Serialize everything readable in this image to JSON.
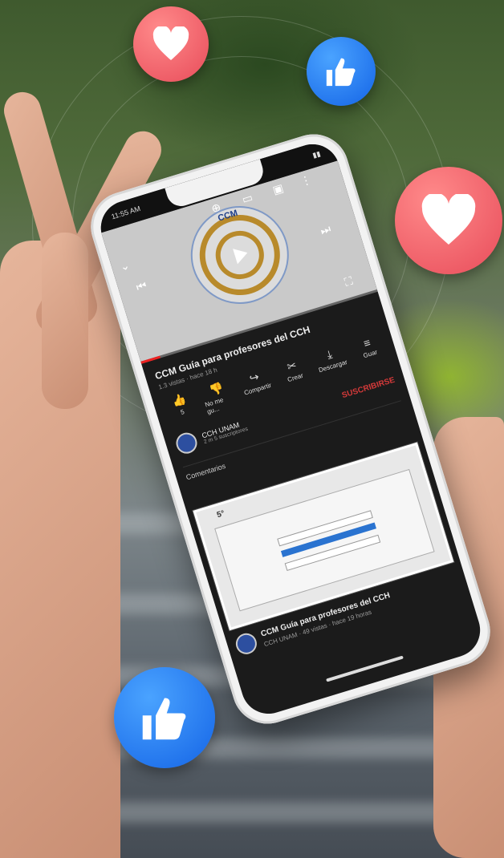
{
  "status": {
    "time": "11:55 AM"
  },
  "video": {
    "logo_text": "CCM",
    "title": "CCM Guía para profesores del CCH",
    "meta": "1.3 vistas · hace 18 h",
    "progress_fraction": 0.08
  },
  "actions": [
    {
      "icon": "thumb-up-icon",
      "label": "5"
    },
    {
      "icon": "thumb-down-icon",
      "label": "No me gu..."
    },
    {
      "icon": "share-icon",
      "label": "Compartir"
    },
    {
      "icon": "clip-icon",
      "label": "Crear"
    },
    {
      "icon": "download-icon",
      "label": "Descargar"
    },
    {
      "icon": "save-icon",
      "label": "Guar"
    }
  ],
  "channel": {
    "name": "CCH UNAM",
    "subs": "2 m 5 suscriptores",
    "subscribe_label": "SUSCRIBIRSE"
  },
  "comments_label": "Comentarios",
  "thumbnail": {
    "badge": "5°"
  },
  "next_video": {
    "title": "CCM Guía para profesores del CCH",
    "meta": "CCH UNAM · 49 vistas · hace 19 horas"
  },
  "colors": {
    "heart": "#e84c5a",
    "like": "#1464e6",
    "subscribe": "#d63a3a"
  }
}
